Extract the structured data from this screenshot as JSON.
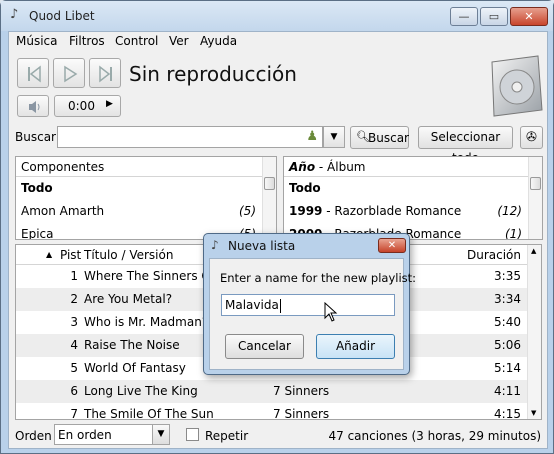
{
  "window": {
    "title": "Quod Libet",
    "icon": "quodlibet-icon",
    "controls": {
      "minimize": "—",
      "maximize": "▭",
      "close": "✕"
    }
  },
  "menu": [
    {
      "label": "Música",
      "key": "M"
    },
    {
      "label": "Filtros",
      "key": "F"
    },
    {
      "label": "Control",
      "key": "C"
    },
    {
      "label": "Ver",
      "key": "V"
    },
    {
      "label": "Ayuda",
      "key": "A"
    }
  ],
  "player": {
    "status": "Sin reproducción",
    "time": "0:00",
    "icons": [
      "previous-icon",
      "play-icon",
      "next-icon",
      "volume-icon",
      "cd-case-icon"
    ]
  },
  "search": {
    "label": "Buscar",
    "button_label": "Buscar",
    "select_all_label": "Seleccionar todo",
    "value": ""
  },
  "left_pane": {
    "header": "Componentes",
    "rows": [
      {
        "label": "Todo",
        "count": "",
        "bold": true
      },
      {
        "label": "Amon Amarth",
        "count": "(5)"
      },
      {
        "label": "Epica",
        "count": "(5)"
      }
    ]
  },
  "right_pane": {
    "header_bold": "Año",
    "header_rest": " - Álbum",
    "rows": [
      {
        "year": "",
        "label": "Todo",
        "count": ""
      },
      {
        "year": "1999",
        "label": " - Razorblade Romance",
        "count": "(12)"
      },
      {
        "year": "2000",
        "label": " - Razorblade Romance",
        "count": "(1)"
      }
    ]
  },
  "tracks": {
    "columns": {
      "num": "Pist",
      "title": "Título / Versión",
      "duration": "Duración"
    },
    "sort_indicator": "▲",
    "rows": [
      {
        "num": "1",
        "title": "Where The Sinners Go",
        "album": "",
        "duration": "3:35"
      },
      {
        "num": "2",
        "title": "Are You Metal?",
        "album": "",
        "duration": "3:34"
      },
      {
        "num": "3",
        "title": "Who is Mr. Madman?",
        "album": "",
        "duration": "5:40"
      },
      {
        "num": "4",
        "title": "Raise The Noise",
        "album": "",
        "duration": "5:06"
      },
      {
        "num": "5",
        "title": "World Of Fantasy",
        "album": "",
        "duration": "5:14"
      },
      {
        "num": "6",
        "title": "Long Live The King",
        "album": "7 Sinners",
        "duration": "4:11"
      },
      {
        "num": "7",
        "title": "The Smile Of The Sun",
        "album": "7 Sinners",
        "duration": "4:15"
      }
    ]
  },
  "footer": {
    "order_label": "Orden",
    "order_value": "En orden",
    "repeat_label": "Repetir",
    "summary": "47 canciones (3 horas, 29 minutos)"
  },
  "dialog": {
    "title": "Nueva lista",
    "prompt": "Enter a name for the new playlist:",
    "input_value": "Malavida",
    "cancel_label": "Cancelar",
    "add_label": "Añadir"
  }
}
